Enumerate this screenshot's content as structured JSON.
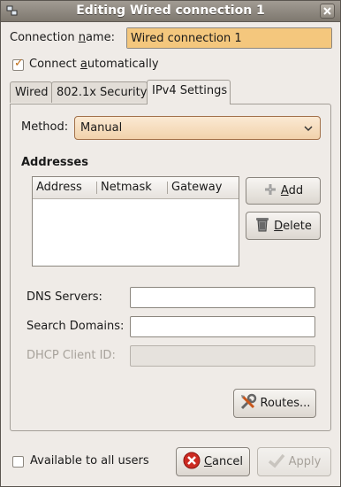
{
  "window": {
    "title": "Editing Wired connection 1"
  },
  "connection": {
    "name_label_pre": "Connection ",
    "name_label_mnemonic": "n",
    "name_label_post": "ame:",
    "name_value": "Wired connection 1",
    "auto_label_pre": "Connect ",
    "auto_label_mnemonic": "a",
    "auto_label_post": "utomatically",
    "auto_checked": true
  },
  "tabs": [
    {
      "label": "Wired",
      "active": false
    },
    {
      "label": "802.1x Security",
      "active": false
    },
    {
      "label": "IPv4 Settings",
      "active": true
    }
  ],
  "ipv4": {
    "method_label": "Method:",
    "method_value": "Manual",
    "addresses_heading": "Addresses",
    "columns": [
      "Address",
      "Netmask",
      "Gateway"
    ],
    "rows": [],
    "add_pre": "",
    "add_mnemonic": "A",
    "add_post": "dd",
    "delete_pre": "",
    "delete_mnemonic": "D",
    "delete_post": "elete",
    "dns_label": "DNS Servers:",
    "dns_value": "",
    "search_label": "Search Domains:",
    "search_value": "",
    "dhcp_label": "DHCP Client ID:",
    "dhcp_value": "",
    "routes_label": "Routes..."
  },
  "footer": {
    "available_label": "Available to all users",
    "available_checked": false,
    "cancel_pre": "",
    "cancel_mnemonic": "C",
    "cancel_post": "ancel",
    "apply_label": "Apply"
  },
  "colors": {
    "titlebar": "#8f8980",
    "selection": "#f4c77d",
    "accent_check": "#c06d16",
    "combo": "#f1d2ab"
  }
}
